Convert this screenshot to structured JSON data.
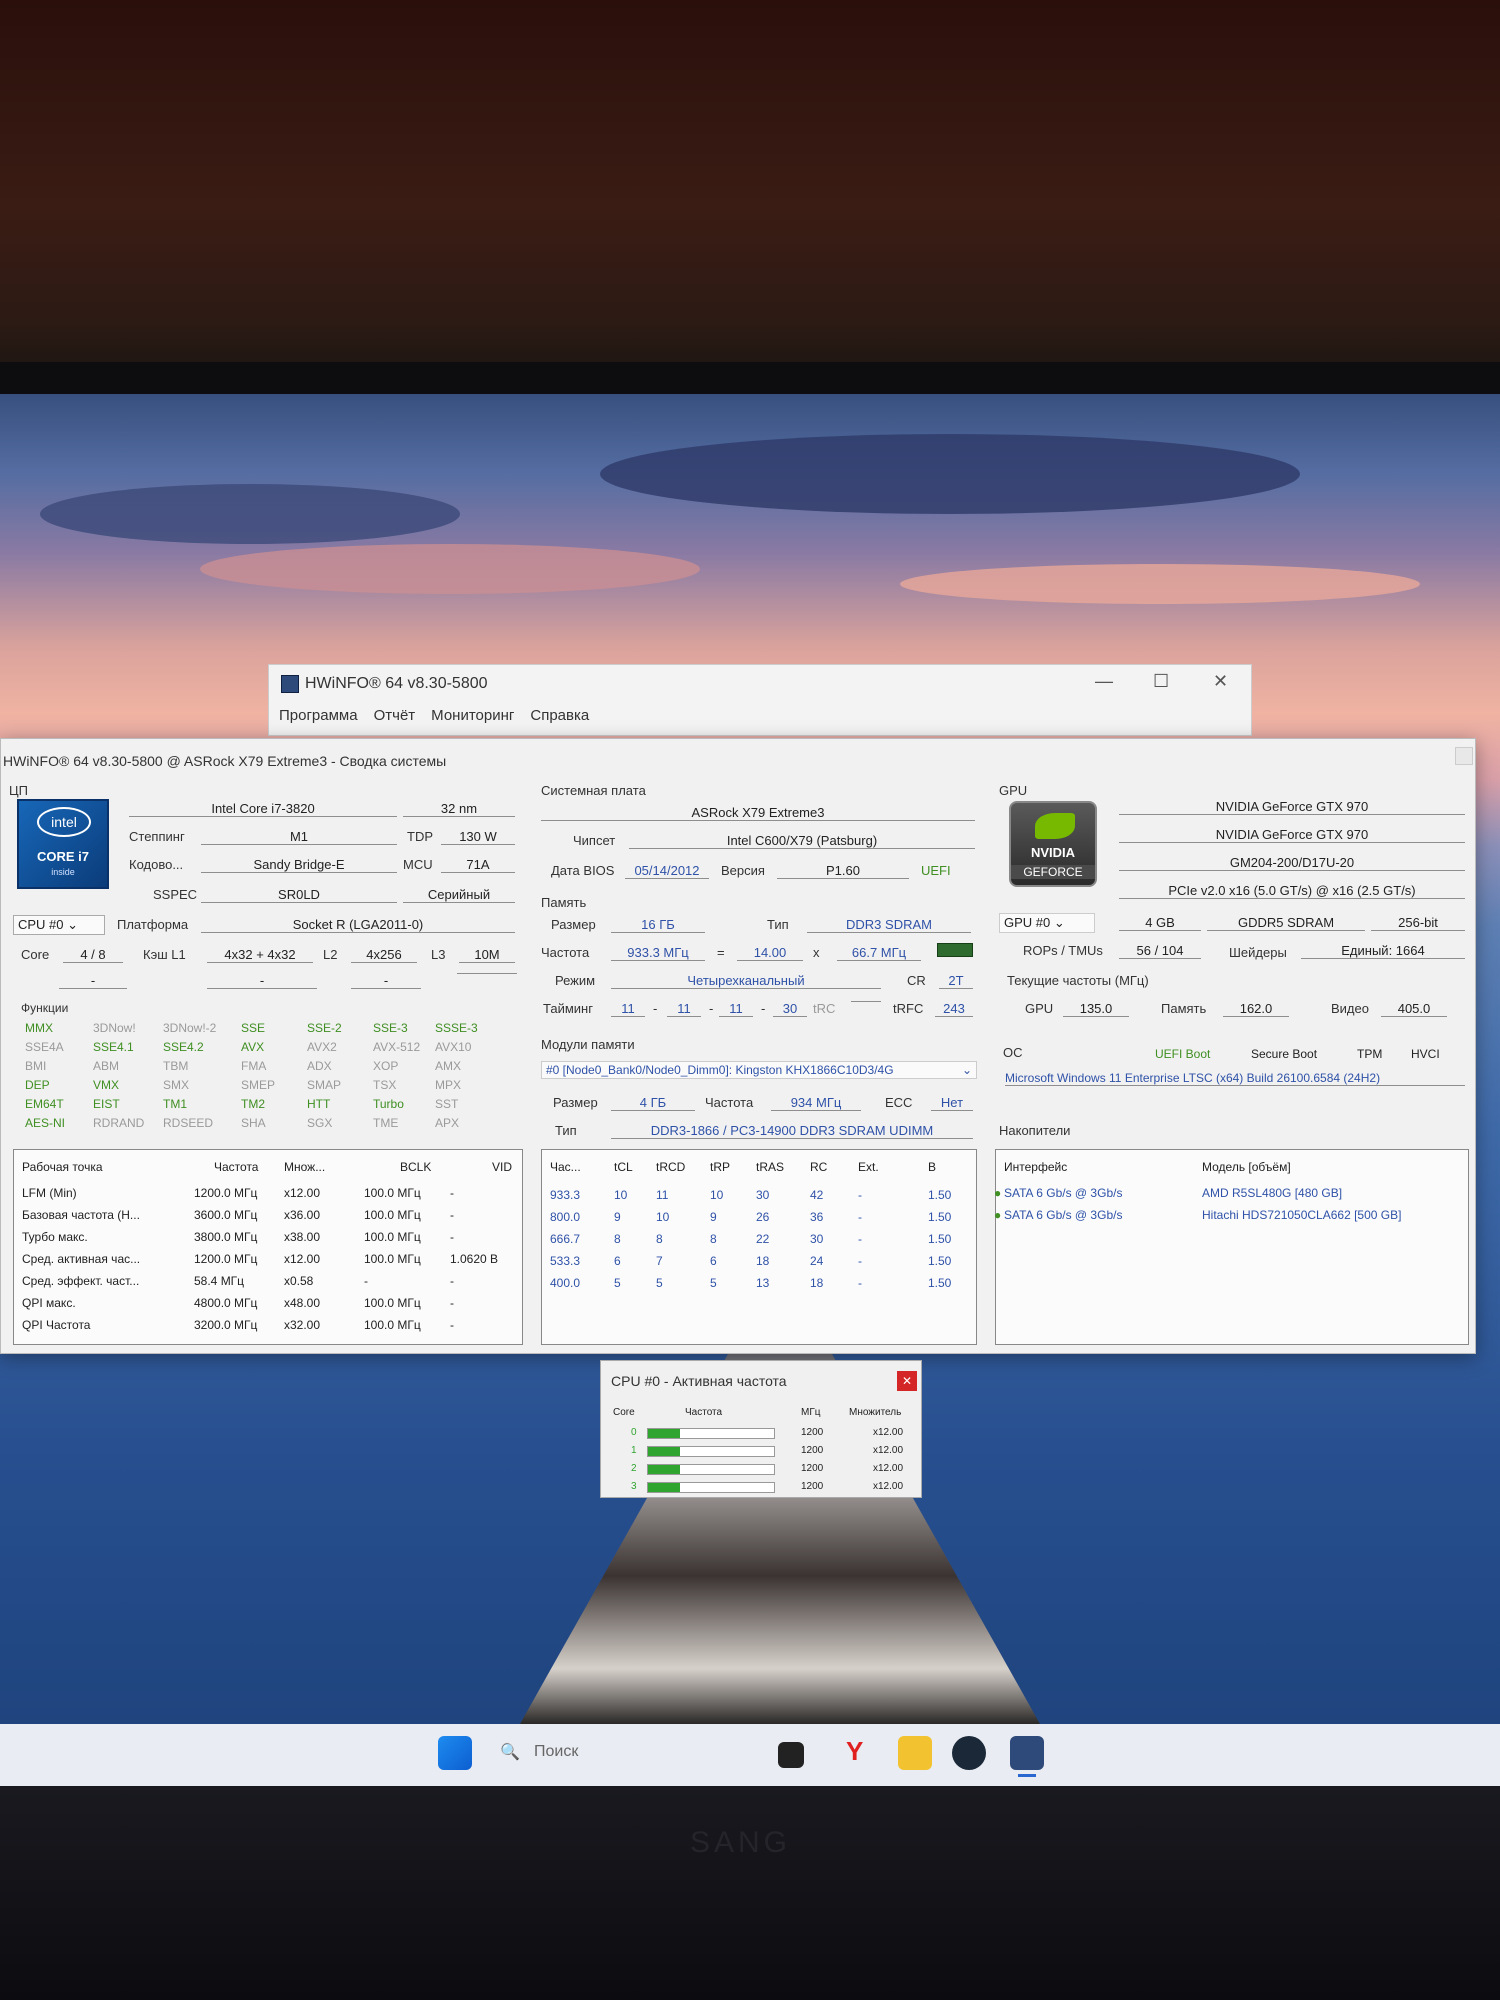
{
  "main_window": {
    "back_title": "HWiNFO® 64 v8.30-5800",
    "menu": [
      "Программа",
      "Отчёт",
      "Мониторинг",
      "Справка"
    ],
    "title": "HWiNFO® 64 v8.30-5800 @ ASRock X79 Extreme3 - Сводка системы"
  },
  "cpu": {
    "section": "ЦП",
    "logo": {
      "brand": "intel",
      "line": "CORE i7",
      "sub": "inside"
    },
    "name": "Intel Core i7-3820",
    "process": "32 nm",
    "stepping_label": "Степпинг",
    "stepping": "M1",
    "tdp_label": "TDP",
    "tdp": "130 W",
    "codename_label": "Кодово...",
    "codename": "Sandy Bridge-E",
    "mcu_label": "MCU",
    "mcu": "71A",
    "sspec_label": "SSPEC",
    "sspec": "SR0LD",
    "prod": "Серийный",
    "selector": "CPU #0",
    "platform_label": "Платформа",
    "platform": "Socket R (LGA2011-0)",
    "core_label": "Core",
    "cores": "4 / 8",
    "l1_label": "Кэш L1",
    "l1": "4x32 + 4x32",
    "l2_label": "L2",
    "l2": "4x256",
    "l3_label": "L3",
    "l3": "10M",
    "dashes": [
      "-",
      "-",
      "-"
    ],
    "features_label": "Функции",
    "features": [
      [
        "MMX",
        "3DNow!",
        "3DNow!-2",
        "SSE",
        "SSE-2",
        "SSE-3",
        "SSSE-3"
      ],
      [
        "SSE4A",
        "SSE4.1",
        "SSE4.2",
        "AVX",
        "AVX2",
        "AVX-512",
        "AVX10"
      ],
      [
        "BMI",
        "ABM",
        "TBM",
        "FMA",
        "ADX",
        "XOP",
        "AMX"
      ],
      [
        "DEP",
        "VMX",
        "SMX",
        "SMEP",
        "SMAP",
        "TSX",
        "MPX"
      ],
      [
        "EM64T",
        "EIST",
        "TM1",
        "TM2",
        "HTT",
        "Turbo",
        "SST"
      ],
      [
        "AES-NI",
        "RDRAND",
        "RDSEED",
        "SHA",
        "SGX",
        "TME",
        "APX"
      ]
    ],
    "feature_enabled": [
      [
        true,
        false,
        false,
        true,
        true,
        true,
        true
      ],
      [
        false,
        true,
        true,
        true,
        false,
        false,
        false
      ],
      [
        false,
        false,
        false,
        false,
        false,
        false,
        false
      ],
      [
        true,
        true,
        false,
        false,
        false,
        false,
        false
      ],
      [
        true,
        true,
        true,
        true,
        true,
        true,
        false
      ],
      [
        true,
        false,
        false,
        false,
        false,
        false,
        false
      ]
    ],
    "op_headers": [
      "Рабочая точка",
      "Частота",
      "Множ...",
      "BCLK",
      "VID"
    ],
    "op_rows": [
      [
        "LFM (Min)",
        "1200.0 МГц",
        "x12.00",
        "100.0 МГц",
        "-"
      ],
      [
        "Базовая частота (Н...",
        "3600.0 МГц",
        "x36.00",
        "100.0 МГц",
        "-"
      ],
      [
        "Турбо макс.",
        "3800.0 МГц",
        "x38.00",
        "100.0 МГц",
        "-"
      ],
      [
        "Сред. активная час...",
        "1200.0 МГц",
        "x12.00",
        "100.0 МГц",
        "1.0620 В"
      ],
      [
        "Сред. эффект. част...",
        "58.4 МГц",
        "x0.58",
        "-",
        "-"
      ],
      [
        "QPI макс.",
        "4800.0 МГц",
        "x48.00",
        "100.0 МГц",
        "-"
      ],
      [
        "QPI Частота",
        "3200.0 МГц",
        "x32.00",
        "100.0 МГц",
        "-"
      ]
    ]
  },
  "mb": {
    "section": "Системная плата",
    "name": "ASRock X79 Extreme3",
    "chipset_label": "Чипсет",
    "chipset": "Intel C600/X79 (Patsburg)",
    "bios_label": "Дата BIOS",
    "bios": "05/14/2012",
    "ver_label": "Версия",
    "ver": "P1.60",
    "uefi": "UEFI"
  },
  "mem": {
    "section": "Память",
    "size_label": "Размер",
    "size": "16 ГБ",
    "type_label": "Тип",
    "type": "DDR3 SDRAM",
    "freq_label": "Частота",
    "freq": "933.3 МГц",
    "eq": "=",
    "mult": "14.00",
    "x": "x",
    "base": "66.7 МГц",
    "mode_label": "Режим",
    "mode": "Четырехканальный",
    "cr_label": "CR",
    "cr": "2T",
    "timing_label": "Тайминг",
    "t1": "11",
    "t2": "11",
    "t3": "11",
    "t4": "30",
    "trc_label": "tRC",
    "trfc_label": "tRFC",
    "trfc": "243",
    "modules_label": "Модули памяти",
    "module": "#0 [Node0_Bank0/Node0_Dimm0]: Kingston KHX1866C10D3/4G",
    "msize_label": "Размер",
    "msize": "4 ГБ",
    "mfreq_label": "Частота",
    "mfreq": "934 МГц",
    "ecc_label": "ECC",
    "ecc": "Нет",
    "mtype_label": "Тип",
    "mtype": "DDR3-1866 / PC3-14900 DDR3 SDRAM UDIMM",
    "t_headers": [
      "Час...",
      "tCL",
      "tRCD",
      "tRP",
      "tRAS",
      "RC",
      "Ext.",
      "В"
    ],
    "t_rows": [
      [
        "933.3",
        "10",
        "11",
        "10",
        "30",
        "42",
        "-",
        "1.50"
      ],
      [
        "800.0",
        "9",
        "10",
        "9",
        "26",
        "36",
        "-",
        "1.50"
      ],
      [
        "666.7",
        "8",
        "8",
        "8",
        "22",
        "30",
        "-",
        "1.50"
      ],
      [
        "533.3",
        "6",
        "7",
        "6",
        "18",
        "24",
        "-",
        "1.50"
      ],
      [
        "400.0",
        "5",
        "5",
        "5",
        "13",
        "18",
        "-",
        "1.50"
      ]
    ]
  },
  "gpu": {
    "section": "GPU",
    "logo": {
      "brand": "NVIDIA",
      "line": "GEFORCE"
    },
    "name1": "NVIDIA GeForce GTX 970",
    "name2": "NVIDIA GeForce GTX 970",
    "chip": "GM204-200/D17U-20",
    "pcie": "PCIe v2.0 x16 (5.0 GT/s) @ x16 (2.5 GT/s)",
    "selector": "GPU #0",
    "vram": "4 GB",
    "vtype": "GDDR5 SDRAM",
    "bus": "256-bit",
    "rops_label": "ROPs / TMUs",
    "rops": "56 / 104",
    "shaders_label": "Шейдеры",
    "shaders": "Единый: 1664",
    "clocks_label": "Текущие частоты (МГц)",
    "gpu_label": "GPU",
    "gpu_clk": "135.0",
    "mem_label": "Память",
    "mem_clk": "162.0",
    "video_label": "Видео",
    "video_clk": "405.0"
  },
  "os": {
    "section": "ОС",
    "uefi": "UEFI Boot",
    "secure": "Secure Boot",
    "tpm": "TPM",
    "hvci": "HVCI",
    "name": "Microsoft Windows 11 Enterprise LTSC (x64) Build 26100.6584 (24H2)"
  },
  "storage": {
    "section": "Накопители",
    "headers": [
      "Интерфейс",
      "Модель [объём]"
    ],
    "rows": [
      [
        "SATA 6 Gb/s @ 3Gb/s",
        "AMD R5SL480G [480 GB]"
      ],
      [
        "SATA 6 Gb/s @ 3Gb/s",
        "Hitachi HDS721050CLA662 [500 GB]"
      ]
    ]
  },
  "active": {
    "title": "CPU #0 - Активная частота",
    "headers": [
      "Core",
      "Частота",
      "МГц",
      "Множитель"
    ],
    "rows": [
      [
        "0",
        "1200",
        "x12.00"
      ],
      [
        "1",
        "1200",
        "x12.00"
      ],
      [
        "2",
        "1200",
        "x12.00"
      ],
      [
        "3",
        "1200",
        "x12.00"
      ]
    ],
    "fill": [
      0.25,
      0.25,
      0.25,
      0.25
    ]
  },
  "taskbar": {
    "search_placeholder": "Поиск"
  },
  "monitor": {
    "brand": "SANG"
  },
  "colors": {
    "accent_green": "#3f8f22",
    "value_blue": "#2f52a8",
    "bar_green": "#2fa52f"
  }
}
